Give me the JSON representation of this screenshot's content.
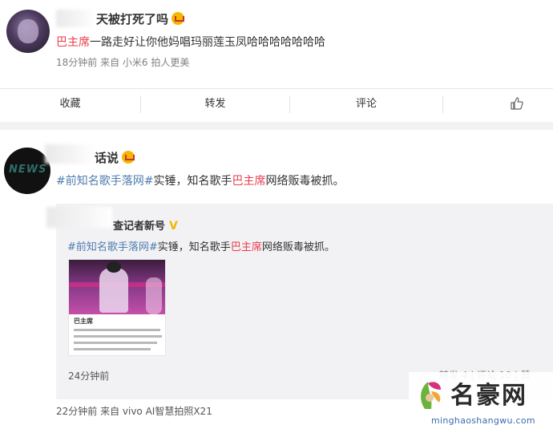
{
  "post1": {
    "author_suffix": "天被打死了吗",
    "mention": "巴主席",
    "text": "一路走好让你他妈唱玛丽莲玉凤哈哈哈哈哈哈哈",
    "meta": "18分钟前 来自 小米6 拍人更美"
  },
  "actions": {
    "collect": "收藏",
    "repost": "转发",
    "comment": "评论"
  },
  "post2": {
    "author_suffix": "话说",
    "avatar_text": "NEWS",
    "topic": "#前知名歌手落网#",
    "text_a": "实锤，知名歌手",
    "mention": "巴主席",
    "text_b": "网络贩毒被抓。",
    "meta": "22分钟前 来自 vivo AI智慧拍照X21"
  },
  "repost": {
    "author_suffix": "查记者新号",
    "topic": "#前知名歌手落网#",
    "text_a": "实锤，知名歌手",
    "mention": "巴主席",
    "text_b": "网络贩毒被抓。",
    "card_title": "巴主席",
    "time": "24分钟前",
    "actions_text": "转发 4 | 评论 10 | 赞"
  },
  "watermark": {
    "brand": "名豪网",
    "url": "minghaoshangwu.com"
  },
  "colors": {
    "mention": "#eb3b4a",
    "topic": "#507daf",
    "crown": "#f7b500"
  }
}
